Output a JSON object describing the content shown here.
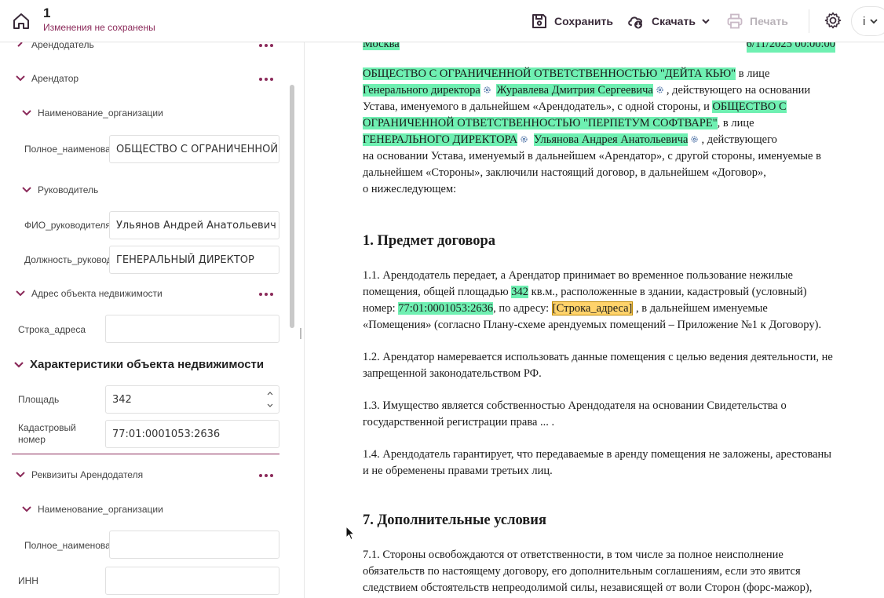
{
  "header": {
    "doc_number": "1",
    "status": "Изменения не сохранены",
    "save_label": "Сохранить",
    "download_label": "Скачать",
    "print_label": "Печать",
    "user_initial": "i",
    "accent_color": "#8b2a5a"
  },
  "form": {
    "sections": {
      "lessor": "Арендодатель",
      "lessee": "Арендатор",
      "org_name": "Наименование_организации",
      "head": "Руководитель",
      "address": "Адрес объекта недвижимости",
      "characteristics": "Характеристики объекта недвижимости",
      "lessor_details": "Реквизиты Арендодателя",
      "org_name_2": "Наименование_организации"
    },
    "fields": {
      "full_name_label": "Полное_наименование",
      "full_name_value": "ОБЩЕСТВО С ОГРАНИЧЕННОЙ ОТВЕТСТВЕННОСТЬЮ",
      "head_fio_label": "ФИО_руководителя",
      "head_fio_value": "Ульянов Андрей Анатольевич",
      "head_position_label": "Должность_руководителя",
      "head_position_value": "ГЕНЕРАЛЬНЫЙ ДИРЕКТОР",
      "address_line_label": "Строка_адреса",
      "address_line_value": "",
      "area_label": "Площадь",
      "area_value": "342",
      "cadastral_label_1": "Кадастровый",
      "cadastral_label_2": "номер",
      "cadastral_value": "77:01:0001053:2636",
      "full_name_2_label": "Полное_наименование",
      "full_name_2_value": "",
      "inn_label": "ИНН",
      "inn_value": ""
    }
  },
  "document": {
    "top_left": "Москва",
    "top_right": "6/11/2025 00:00:00",
    "intro": {
      "org1": "ОБЩЕСТВО С ОГРАНИЧЕННОЙ ОТВЕТСТВЕННОСТЬЮ \"ДЕЙТА КЬЮ\"",
      "t1": " в лице",
      "pos1": "Генерального директора",
      "name1": "Журавлева Дмитрия Сергеевича",
      "t2": ", действующего на основании Устава, именуемого в дальнейшем «Арендодатель», с одной стороны, и ",
      "org2": "ОБЩЕСТВО С ОГРАНИЧЕННОЙ ОТВЕТСТВЕННОСТЬЮ \"ПЕРПЕТУМ СОФТВАРЕ\"",
      "t3": ", в лице",
      "pos2": "ГЕНЕРАЛЬНОГО ДИРЕКТОРА",
      "name2": "Ульянова Андрея Анатольевича",
      "t4": ", действующего",
      "t5": "на основании Устава, именуемый в дальнейшем «Арендатор», с другой стороны, именуемые в дальнейшем «Стороны», заключили настоящий договор, в дальнейшем «Договор»,",
      "t6": "о нижеследующем:"
    },
    "h1": "1. Предмет договора",
    "p11": {
      "a": "1.1. Арендодатель передает, а Арендатор принимает во временное пользование нежилые помещения, общей площадью ",
      "area": "342",
      "b": " кв.м., расположенные в здании, кадастровый (условный) номер: ",
      "cad": "77:01:0001053:2636",
      "c": ", по адресу: ",
      "addr": "[Строка_адреса]",
      "d": " , в дальнейшем именуемые «Помещения» (согласно Плану-схеме арендуемых помещений – Приложение №1 к Договору)."
    },
    "p12": "1.2. Арендатор намеревается использовать данные помещения с целью ведения деятельности, не запрещенной законодательством РФ.",
    "p13": "1.3. Имущество является собственностью Арендодателя на основании Свидетельства о государственной регистрации права ... .",
    "p14": "1.4. Арендодатель гарантирует, что передаваемые в аренду помещения не заложены, арестованы и не обременены правами третьих лиц.",
    "h7": "7. Дополнительные условия",
    "p71": "7.1. Стороны освобождаются от ответственности, в том числе за полное неисполнение обязательств по настоящему договору, его дополнительным соглашениям, если это явится следствием обстоятельств непреодолимой силы, независящей от воли Сторон (форс-мажор),"
  }
}
